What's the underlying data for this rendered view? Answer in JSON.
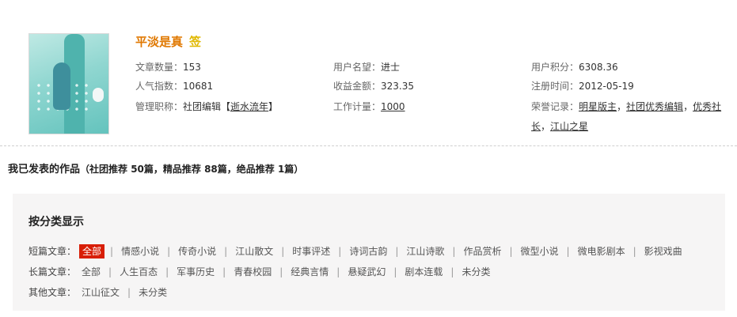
{
  "profile": {
    "name": "平淡是真",
    "sign_badge": "签",
    "fields": {
      "article_count": {
        "label": "文章数量：",
        "value": "153"
      },
      "popularity": {
        "label": "人气指数：",
        "value": "10681"
      },
      "admin_title": {
        "label": "管理职称：",
        "value_prefix": "社团编辑【",
        "link": "逝水流年",
        "value_suffix": "】"
      },
      "reputation": {
        "label": "用户名望：",
        "value": "进士"
      },
      "income": {
        "label": "收益金额：",
        "value": "323.35"
      },
      "workload": {
        "label": "工作计量：",
        "value": "1000"
      },
      "points": {
        "label": "用户积分：",
        "value": "6308.36"
      },
      "register_time": {
        "label": "注册时间：",
        "value": "2012-05-19"
      },
      "honors": {
        "label": "荣誉记录：",
        "items": [
          "明星版主",
          "社团优秀编辑",
          "优秀社",
          "长",
          "江山之星"
        ],
        "separator": "，"
      }
    }
  },
  "works": {
    "title": "我已发表的作品",
    "summary": "（社团推荐 50篇，精品推荐 88篇，绝品推荐 1篇）"
  },
  "categories": {
    "title": "按分类显示",
    "rows": [
      {
        "label": "短篇文章：",
        "items": [
          "全部",
          "情感小说",
          "传奇小说",
          "江山散文",
          "时事评述",
          "诗词古韵",
          "江山诗歌",
          "作品赏析",
          "微型小说",
          "微电影剧本",
          "影视戏曲"
        ]
      },
      {
        "label": "长篇文章：",
        "items": [
          "全部",
          "人生百态",
          "军事历史",
          "青春校园",
          "经典言情",
          "悬疑武幻",
          "剧本连载",
          "未分类"
        ]
      },
      {
        "label": "其他文章：",
        "items": [
          "江山征文",
          "未分类"
        ]
      }
    ],
    "active": "全部"
  },
  "colors": {
    "name": "#e07800",
    "sign": "#e0b800",
    "active_bg": "#d81e06",
    "box_bg": "#f6f5f5"
  }
}
